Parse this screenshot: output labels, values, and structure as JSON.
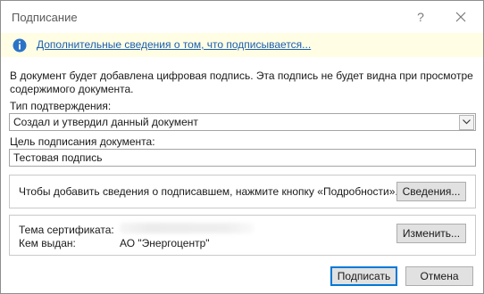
{
  "window": {
    "title": "Подписание",
    "help_label": "?"
  },
  "infobar": {
    "link_text": "Дополнительные сведения о том, что подписывается..."
  },
  "description": "В документ будет добавлена цифровая подпись. Эта подпись не будет видна при просмотре содержимого документа.",
  "commitment_type": {
    "label": "Тип подтверждения:",
    "value": "Создал и утвердил данный документ"
  },
  "purpose": {
    "label": "Цель подписания документа:",
    "value": "Тестовая подпись"
  },
  "details_group": {
    "text": "Чтобы добавить сведения о подписавшем, нажмите кнопку «Подробности».",
    "button_label": "Сведения..."
  },
  "certificate": {
    "subject_label": "Тема сертификата:",
    "issuer_label": "Кем выдан:",
    "issuer_value": "АО \"Энергоцентр\"",
    "change_button_label": "Изменить..."
  },
  "footer": {
    "sign_label": "Подписать",
    "cancel_label": "Отмена"
  },
  "colors": {
    "link": "#1a5fb4",
    "infobar_bg": "#fffde3",
    "info_icon": "#2b73c8",
    "default_button_border": "#0078d7"
  },
  "icons": {
    "info": "info-icon",
    "close": "close-icon",
    "dropdown": "chevron-down-icon"
  }
}
